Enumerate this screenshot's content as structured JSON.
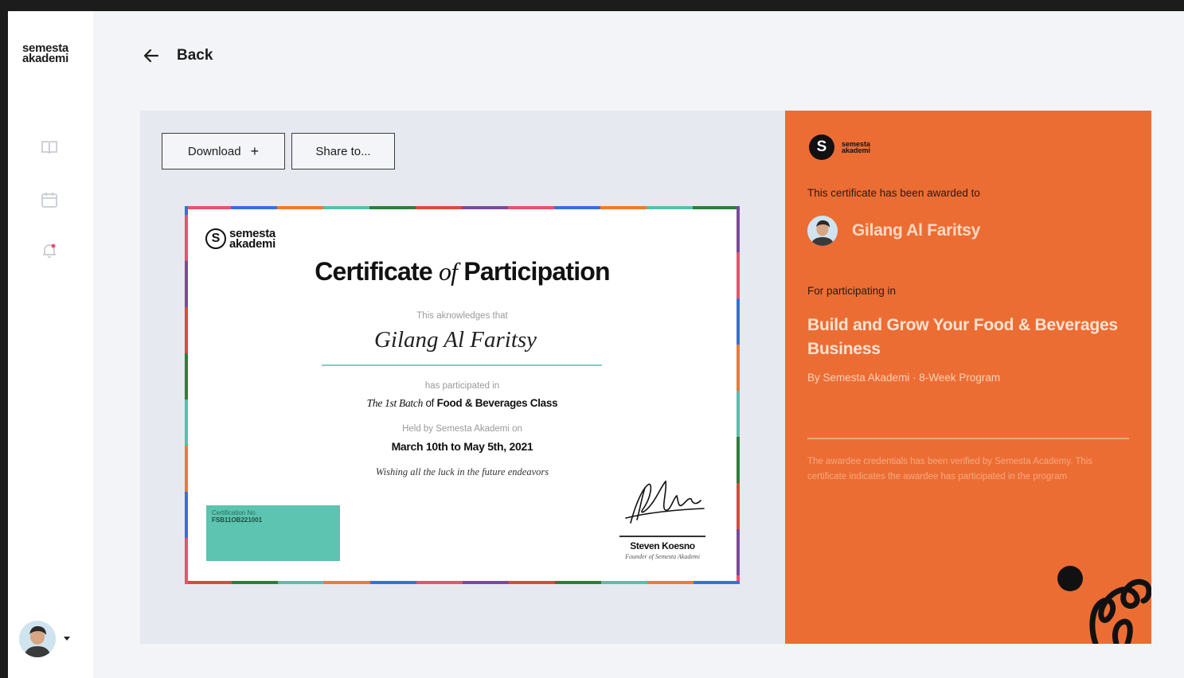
{
  "sidebar": {
    "logo": [
      "semesta",
      "akademi"
    ],
    "nav_icons": [
      "book-icon",
      "calendar-icon",
      "notification-icon"
    ]
  },
  "header": {
    "back_label": "Back"
  },
  "toolbar": {
    "download_label": "Download",
    "download_icon": "+",
    "share_label": "Share to..."
  },
  "certificate": {
    "logo": [
      "semesta",
      "akademi"
    ],
    "title_prefix": "Certificate",
    "title_of": "of",
    "title_suffix": "Participation",
    "acknowledges": "This aknowledges that",
    "recipient": "Gilang Al Faritsy",
    "participated": "has participated in",
    "batch_italic": "The 1st Batch",
    "batch_of": "of",
    "batch_bold": "Food & Beverages Class",
    "held_by": "Held by Semesta Akademi on",
    "dates": "March 10th to May 5th, 2021",
    "wishing": "Wishing all the luck in the future endeavors",
    "cert_no_label": "Certification No.",
    "cert_no_value": "FSB11OB221001",
    "signer": "Steven Koesno",
    "signer_role": "Founder of Semesta Akademi",
    "border_colors": [
      "#e8526d",
      "#3a6fd8",
      "#f07a2f",
      "#52c2ac",
      "#2e7d3a",
      "#d94a3a",
      "#7a4a9a"
    ]
  },
  "award_panel": {
    "logo": [
      "semesta",
      "akademi"
    ],
    "awarded_text": "This certificate has been awarded to",
    "recipient": "Gilang Al Faritsy",
    "for_text": "For participating in",
    "course_title": "Build and Grow Your Food & Beverages Business",
    "by_line": "By Semesta Akademi · 8-Week Program",
    "verification_note": "The awardee credentials has been verified by Semesta Academy. This certificate indicates the awardee has participated in the program",
    "accent_color": "#ec6d33"
  }
}
